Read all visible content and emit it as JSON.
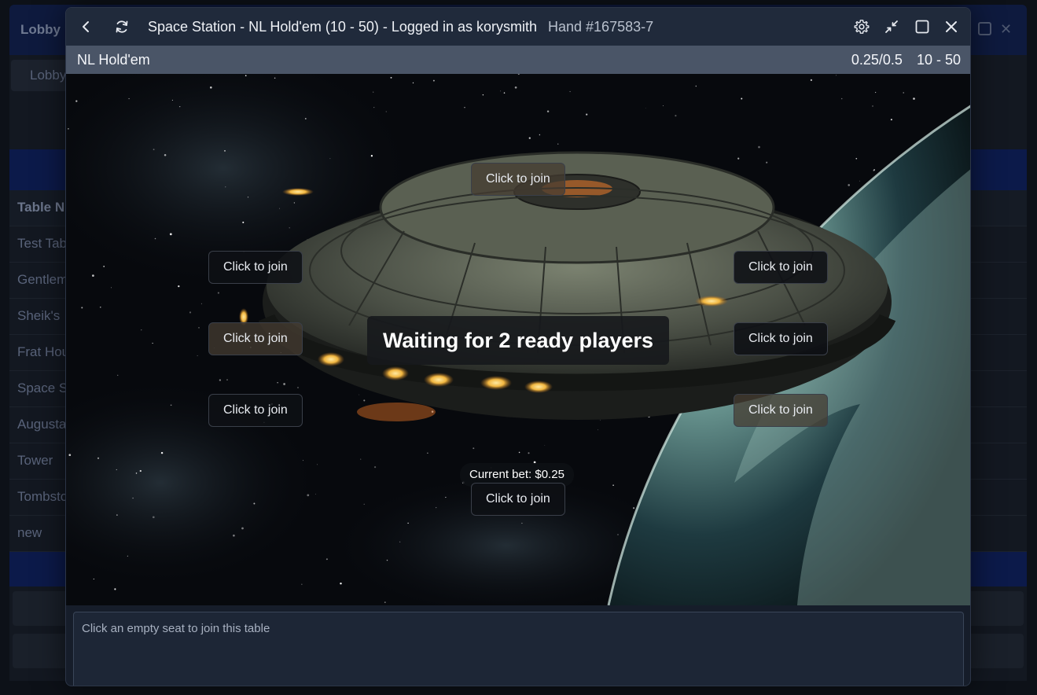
{
  "lobby": {
    "title": "Lobby",
    "tab": "Lobby",
    "header": "Table N",
    "rows": [
      "Test Tab",
      "Gentlem",
      "Sheik's",
      "Frat Hou",
      "Space S",
      "Augusta",
      "Tower",
      "Tombsto",
      "new"
    ]
  },
  "dialog": {
    "title": "Space Station - NL Hold'em (10 - 50) - Logged in as korysmith",
    "hand": "Hand #167583-7",
    "icons": [
      "back-icon",
      "refresh-icon",
      "gear-icon",
      "minimize-icon",
      "maximize-icon",
      "close-icon"
    ]
  },
  "subbar": {
    "game": "NL Hold'em",
    "blinds": "0.25/0.5",
    "buyin": "10 - 50"
  },
  "table": {
    "status": "Waiting for 2 ready players",
    "current_bet": "Current bet: $0.25",
    "seats": [
      {
        "label": "Click to join"
      },
      {
        "label": "Click to join"
      },
      {
        "label": "Click to join"
      },
      {
        "label": "Click to join"
      },
      {
        "label": "Click to join"
      },
      {
        "label": "Click to join"
      },
      {
        "label": "Click to join"
      },
      {
        "label": "Click to join"
      }
    ]
  },
  "message": {
    "text": "Click an empty seat to join this table"
  },
  "colors": {
    "titlebar": "#202a3b",
    "subbar": "#4a5567",
    "lobby_band": "#0c1a4a"
  }
}
